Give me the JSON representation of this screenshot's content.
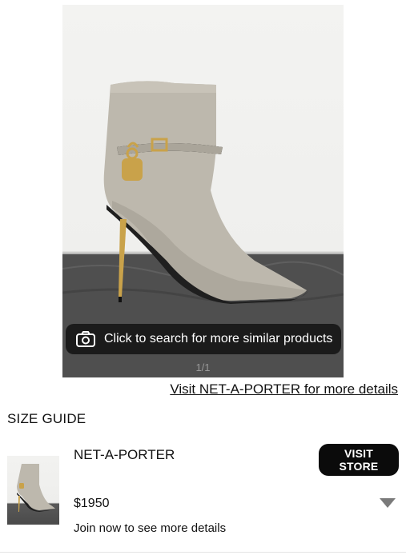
{
  "image_search": {
    "label": "Click to search for more similar products",
    "counter": "1/1",
    "camera_icon": "camera-icon"
  },
  "visit_link": "Visit NET-A-PORTER for more details",
  "size_guide": "SIZE GUIDE",
  "offer": {
    "retailer": "NET-A-PORTER",
    "visit_button": "VISIT STORE",
    "price": "$1950",
    "details": "Join now to see more details",
    "expand_icon": "triangle-down-icon"
  },
  "colors": {
    "pill_background": "#141414",
    "button_background": "#0b0b0b",
    "boot_suede": "#bdb8ad",
    "heel_gold": "#c9a24a"
  }
}
